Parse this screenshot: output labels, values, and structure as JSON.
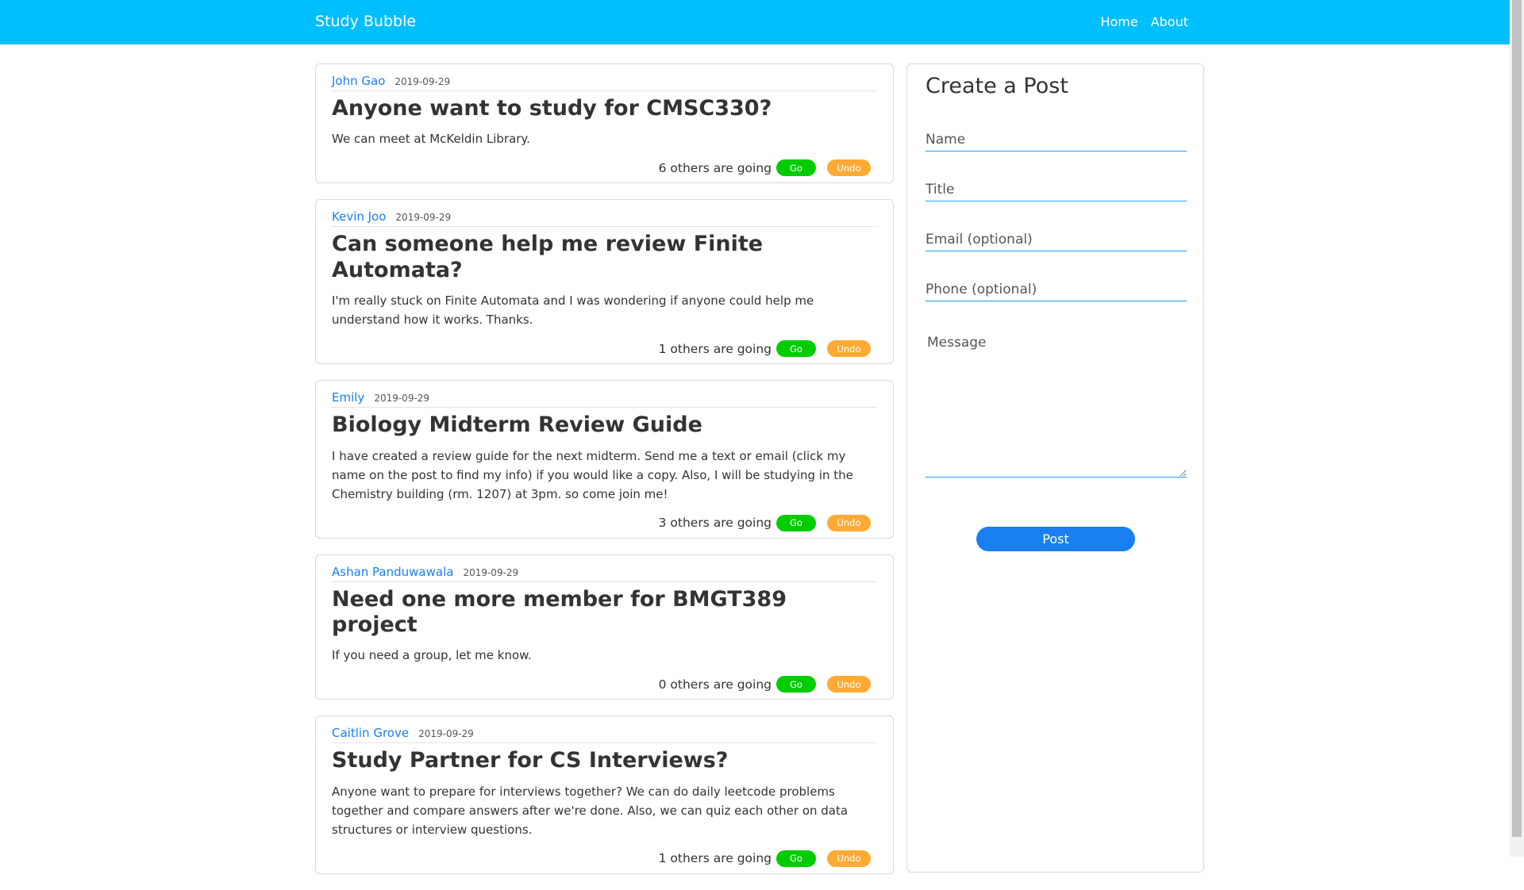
{
  "navbar": {
    "brand": "Study Bubble",
    "links": [
      "Home",
      "About"
    ]
  },
  "colors": {
    "navbar": "#00bfff",
    "go": "#00cc00",
    "undo": "#ffaa33",
    "primary": "#1a7ff0"
  },
  "posts": [
    {
      "author": "John Gao",
      "date": "2019-09-29",
      "title": "Anyone want to study for CMSC330?",
      "body": "We can meet at McKeldin Library.",
      "going_text": "6 others are going",
      "go_label": "Go",
      "undo_label": "Undo"
    },
    {
      "author": "Kevin Joo",
      "date": "2019-09-29",
      "title": "Can someone help me review Finite Automata?",
      "body": "I'm really stuck on Finite Automata and I was wondering if anyone could help me understand how it works. Thanks.",
      "going_text": "1 others are going",
      "go_label": "Go",
      "undo_label": "Undo"
    },
    {
      "author": "Emily",
      "date": "2019-09-29",
      "title": "Biology Midterm Review Guide",
      "body": "I have created a review guide for the next midterm. Send me a text or email (click my name on the post to find my info) if you would like a copy. Also, I will be studying in the Chemistry building (rm. 1207) at 3pm. so come join me!",
      "going_text": "3 others are going",
      "go_label": "Go",
      "undo_label": "Undo"
    },
    {
      "author": "Ashan Panduwawala",
      "date": "2019-09-29",
      "title": "Need one more member for BMGT389 project",
      "body": "If you need a group, let me know.",
      "going_text": "0 others are going",
      "go_label": "Go",
      "undo_label": "Undo"
    },
    {
      "author": "Caitlin Grove",
      "date": "2019-09-29",
      "title": "Study Partner for CS Interviews?",
      "body": "Anyone want to prepare for interviews together? We can do daily leetcode problems together and compare answers after we're done. Also, we can quiz each other on data structures or interview questions.",
      "going_text": "1 others are going",
      "go_label": "Go",
      "undo_label": "Undo"
    }
  ],
  "create_post": {
    "title": "Create a Post",
    "name_placeholder": "Name",
    "title_placeholder": "Title",
    "email_placeholder": "Email (optional)",
    "phone_placeholder": "Phone (optional)",
    "message_placeholder": "Message",
    "submit_label": "Post"
  }
}
